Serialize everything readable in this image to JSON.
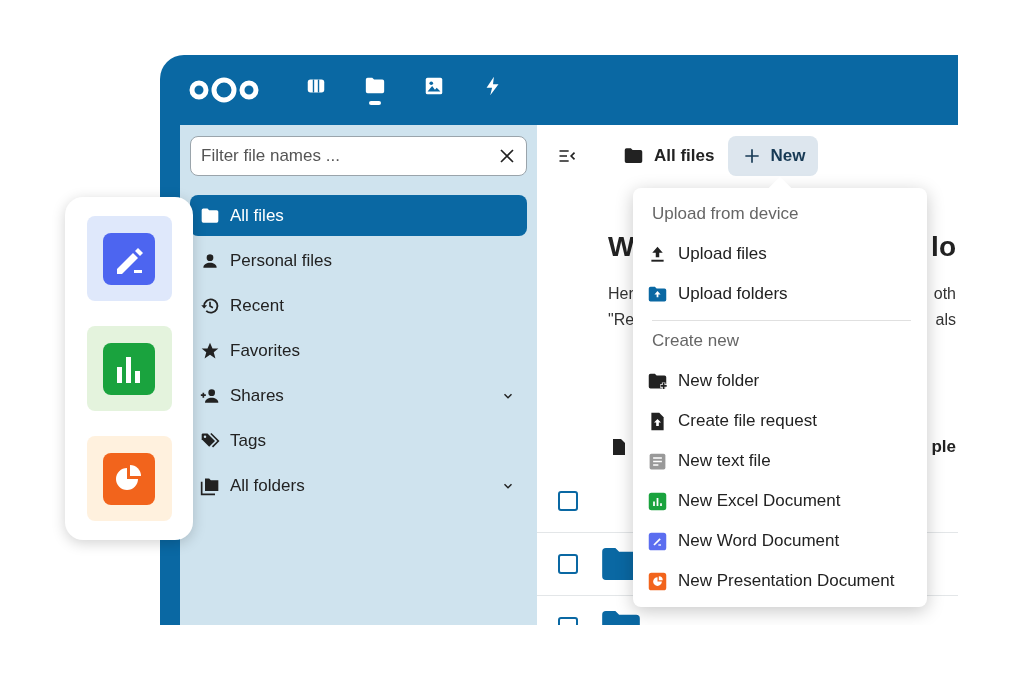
{
  "header": {
    "nav": [
      {
        "selected": false
      },
      {
        "selected": true
      },
      {
        "selected": false
      },
      {
        "selected": false
      }
    ]
  },
  "sidebar": {
    "filter": {
      "placeholder": "Filter file names ..."
    },
    "items": [
      {
        "label": "All files",
        "selected": true,
        "expandable": false
      },
      {
        "label": "Personal files",
        "selected": false,
        "expandable": false
      },
      {
        "label": "Recent",
        "selected": false,
        "expandable": false
      },
      {
        "label": "Favorites",
        "selected": false,
        "expandable": false
      },
      {
        "label": "Shares",
        "selected": false,
        "expandable": true
      },
      {
        "label": "Tags",
        "selected": false,
        "expandable": false
      },
      {
        "label": "All folders",
        "selected": false,
        "expandable": true
      }
    ]
  },
  "toolbar": {
    "breadcrumb": "All files",
    "new_button": "New"
  },
  "content": {
    "heading_fragments": [
      "W",
      "lo"
    ],
    "intro_lines": [
      [
        "Her",
        "oth"
      ],
      [
        "\"Re",
        "als"
      ]
    ],
    "column_header": "ple",
    "rows": [
      {
        "checked": false,
        "folder": false
      },
      {
        "checked": false,
        "folder": true
      },
      {
        "checked": false,
        "folder": true
      }
    ]
  },
  "new_menu": {
    "sections": [
      {
        "title": "Upload from device",
        "items": [
          "Upload files",
          "Upload folders"
        ]
      },
      {
        "title": "Create new",
        "items": [
          "New folder",
          "Create file request",
          "New text file",
          "New Excel Document",
          "New Word Document",
          "New Presentation Document"
        ]
      }
    ]
  },
  "app_card": {
    "tiles": [
      {
        "color": "#4d65f0"
      },
      {
        "color": "#1aa33e"
      },
      {
        "color": "#f2641c"
      }
    ]
  }
}
